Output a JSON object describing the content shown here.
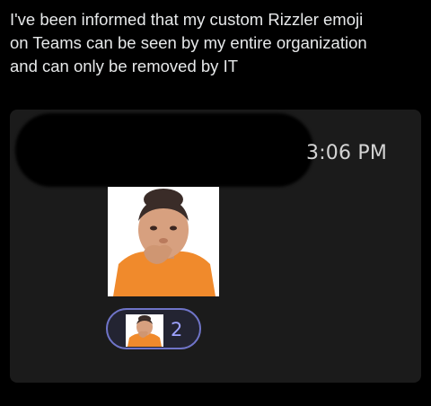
{
  "post": {
    "lines": [
      "I've been informed that my custom Rizzler emoji",
      "on Teams can be seen by my entire organization",
      "and can only be removed by IT"
    ]
  },
  "message": {
    "sender_redacted": true,
    "timestamp": "3:06 PM",
    "sticker_icon": "rizzler-face-emoji",
    "reaction": {
      "icon": "rizzler-face-emoji",
      "count": "2",
      "accent_color": "#6f74c8"
    }
  },
  "colors": {
    "background": "#000000",
    "card": "#1b1b1b",
    "text": "#e7e9ea",
    "shirt": "#f08a2c"
  }
}
